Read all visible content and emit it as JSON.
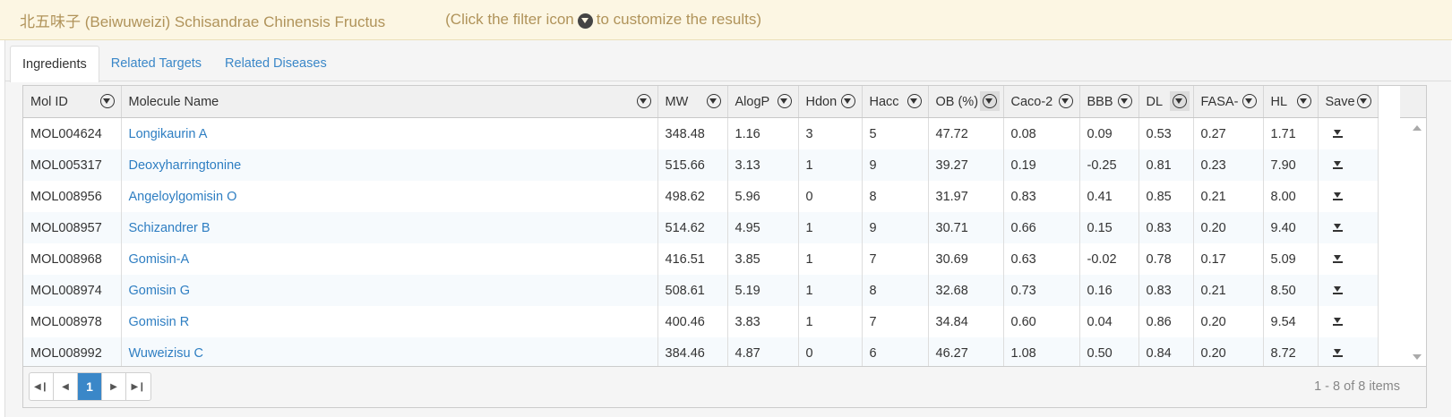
{
  "banner": {
    "title": "北五味子 (Beiwuweizi) Schisandrae Chinensis Fructus",
    "hint_before": "(Click the filter icon",
    "hint_after": "to customize the results)"
  },
  "tabs": [
    {
      "label": "Ingredients",
      "active": true
    },
    {
      "label": "Related Targets",
      "active": false
    },
    {
      "label": "Related Diseases",
      "active": false
    }
  ],
  "columns": [
    "Mol ID",
    "Molecule Name",
    "MW",
    "AlogP",
    "Hdon",
    "Hacc",
    "OB (%)",
    "Caco-2",
    "BBB",
    "DL",
    "FASA-",
    "HL",
    "Save"
  ],
  "rows": [
    [
      "MOL004624",
      "Longikaurin A",
      "348.48",
      "1.16",
      "3",
      "5",
      "47.72",
      "0.08",
      "0.09",
      "0.53",
      "0.27",
      "1.71"
    ],
    [
      "MOL005317",
      "Deoxyharringtonine",
      "515.66",
      "3.13",
      "1",
      "9",
      "39.27",
      "0.19",
      "-0.25",
      "0.81",
      "0.23",
      "7.90"
    ],
    [
      "MOL008956",
      "Angeloylgomisin O",
      "498.62",
      "5.96",
      "0",
      "8",
      "31.97",
      "0.83",
      "0.41",
      "0.85",
      "0.21",
      "8.00"
    ],
    [
      "MOL008957",
      "Schizandrer B",
      "514.62",
      "4.95",
      "1",
      "9",
      "30.71",
      "0.66",
      "0.15",
      "0.83",
      "0.20",
      "9.40"
    ],
    [
      "MOL008968",
      "Gomisin-A",
      "416.51",
      "3.85",
      "1",
      "7",
      "30.69",
      "0.63",
      "-0.02",
      "0.78",
      "0.17",
      "5.09"
    ],
    [
      "MOL008974",
      "Gomisin G",
      "508.61",
      "5.19",
      "1",
      "8",
      "32.68",
      "0.73",
      "0.16",
      "0.83",
      "0.21",
      "8.50"
    ],
    [
      "MOL008978",
      "Gomisin R",
      "400.46",
      "3.83",
      "1",
      "7",
      "34.84",
      "0.60",
      "0.04",
      "0.86",
      "0.20",
      "9.54"
    ],
    [
      "MOL008992",
      "Wuweizisu C",
      "384.46",
      "4.87",
      "0",
      "6",
      "46.27",
      "1.08",
      "0.50",
      "0.84",
      "0.20",
      "8.72"
    ]
  ],
  "pager": {
    "current_page": "1",
    "info": "1 - 8 of 8 items"
  }
}
